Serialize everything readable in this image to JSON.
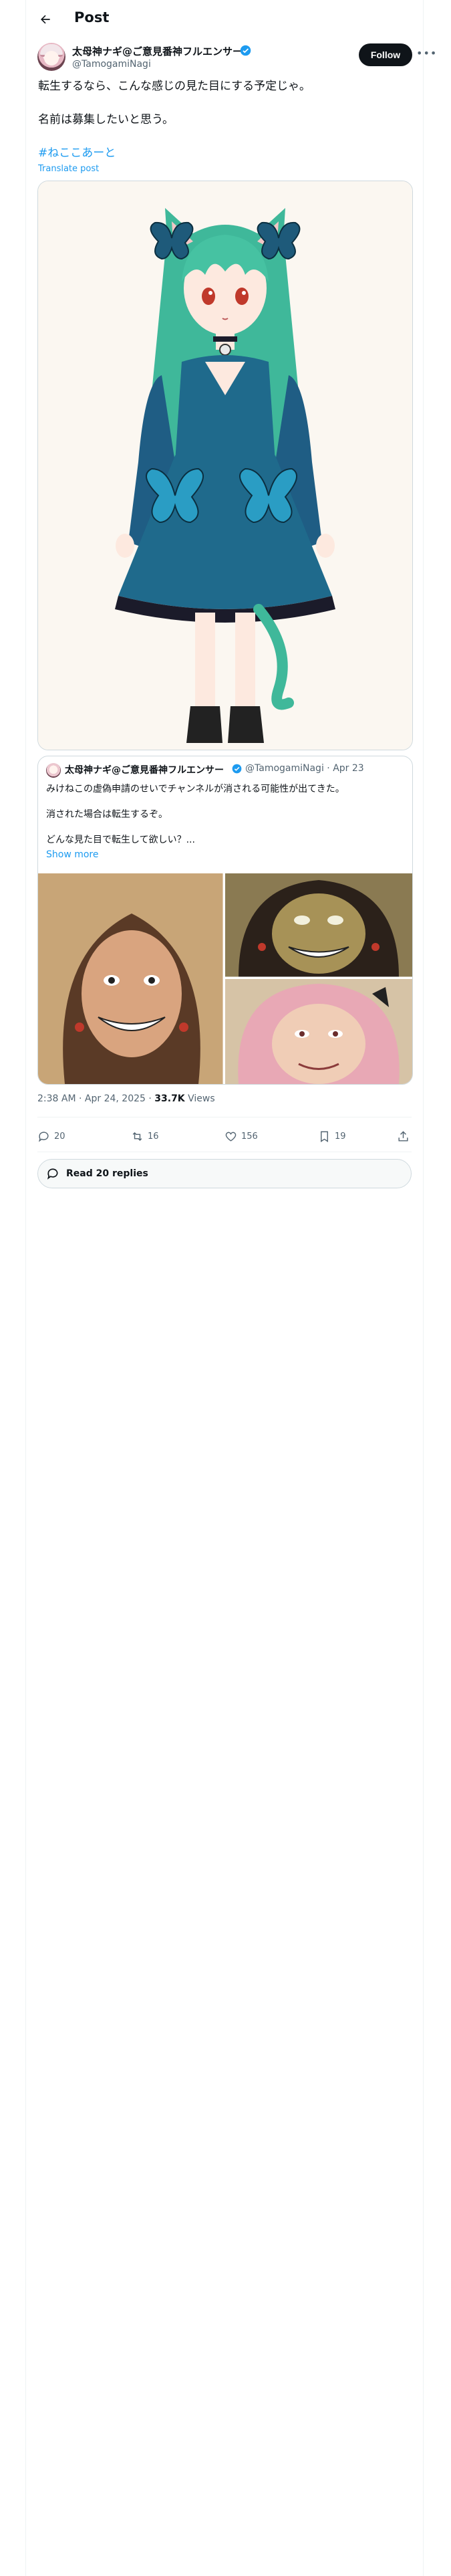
{
  "header": {
    "title": "Post"
  },
  "author": {
    "name": "太母神ナギ@ご意見番神フルエンサー",
    "handle": "@TamogamiNagi",
    "follow_label": "Follow"
  },
  "tweet": {
    "line1": "転生するなら、こんな感じの見た目にする予定じゃ。",
    "line2": "名前は募集したいと思う。",
    "hashtag": "#ねここあーと",
    "translate": "Translate post"
  },
  "quote": {
    "name": "太母神ナギ@ご意見番神フルエンサー",
    "handle": "@TamogamiNagi",
    "date": "Apr 23",
    "line1": "みけねこの虚偽申請のせいでチャンネルが消される可能性が出てきた。",
    "line2": "消された場合は転生するぞ。",
    "line3": "どんな見た目で転生して欲しい？...",
    "show_more": "Show more"
  },
  "meta": {
    "time": "2:38 AM · Apr 24, 2025 · ",
    "views_count": "33.7K",
    "views_label": " Views"
  },
  "actions": {
    "replies": "20",
    "reposts": "16",
    "likes": "156",
    "bookmarks": "19"
  },
  "read_replies": "Read 20 replies",
  "colors": {
    "accent": "#1d9bf0",
    "text": "#0f1419",
    "muted": "#536471"
  }
}
